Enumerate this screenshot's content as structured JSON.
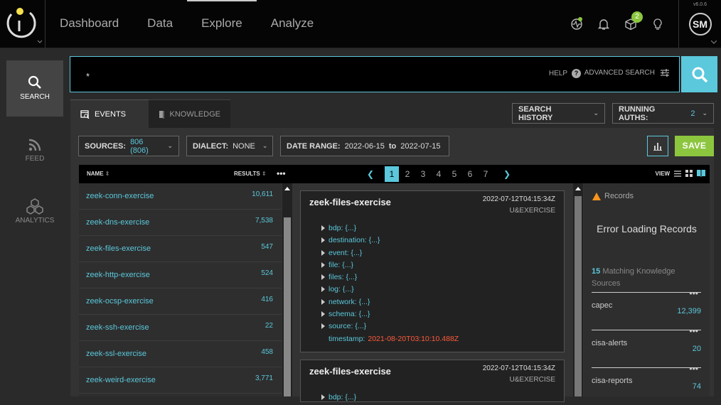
{
  "version": "v6.0.6",
  "nav": [
    "Dashboard",
    "Data",
    "Explore",
    "Analyze"
  ],
  "user_initials": "SM",
  "cube_badge": "2",
  "sidebar": [
    {
      "label": "SEARCH"
    },
    {
      "label": "FEED"
    },
    {
      "label": "ANALYTICS"
    }
  ],
  "search": {
    "value": "*",
    "help": "HELP",
    "advanced": "ADVANCED SEARCH"
  },
  "tabs": {
    "events": "EVENTS",
    "knowledge": "KNOWLEDGE"
  },
  "toolbar": {
    "search_history": "SEARCH HISTORY",
    "running_auths_label": "RUNNING AUTHS:",
    "running_auths_value": "2",
    "sources_label": "SOURCES:",
    "sources_value": "806 (806)",
    "dialect_label": "DIALECT:",
    "dialect_value": "NONE",
    "date_label": "DATE RANGE:",
    "date_from": "2022-06-15",
    "date_to_word": "to",
    "date_to": "2022-07-15",
    "save": "SAVE"
  },
  "list_header": {
    "name": "NAME",
    "results": "RESULTS",
    "more": "•••"
  },
  "pager": {
    "pages": [
      "1",
      "2",
      "3",
      "4",
      "5",
      "6",
      "7"
    ],
    "active": "1",
    "view": "VIEW"
  },
  "sources": [
    {
      "name": "zeek-conn-exercise",
      "count": "10,611"
    },
    {
      "name": "zeek-dns-exercise",
      "count": "7,538"
    },
    {
      "name": "zeek-files-exercise",
      "count": "547"
    },
    {
      "name": "zeek-http-exercise",
      "count": "524"
    },
    {
      "name": "zeek-ocsp-exercise",
      "count": "416"
    },
    {
      "name": "zeek-ssh-exercise",
      "count": "22"
    },
    {
      "name": "zeek-ssl-exercise",
      "count": "458"
    },
    {
      "name": "zeek-weird-exercise",
      "count": "3,771"
    }
  ],
  "records": [
    {
      "title": "zeek-files-exercise",
      "timestamp": "2022-07-12T04:15:34Z",
      "source": "U&EXERCISE",
      "fields": [
        "bdp: {...}",
        "destination: {...}",
        "event: {...}",
        "file: {...}",
        "files: {...}",
        "log: {...}",
        "network: {...}",
        "schema: {...}",
        "source: {...}"
      ],
      "ts_label": "timestamp:",
      "ts_value": "2021-08-20T03:10:10.488Z"
    },
    {
      "title": "zeek-files-exercise",
      "timestamp": "2022-07-12T04:15:34Z",
      "source": "U&EXERCISE",
      "partial_field": "bdp: {...}"
    }
  ],
  "knowledge_panel": {
    "heading": "Records",
    "error": "Error Loading Records",
    "match_count": "15",
    "match_text": "Matching Knowledge Sources",
    "items": [
      {
        "name": "capec",
        "count": "12,399",
        "more": "•••"
      },
      {
        "name": "cisa-alerts",
        "count": "20",
        "more": "•••"
      },
      {
        "name": "cisa-reports",
        "count": "74",
        "more": "•••"
      }
    ]
  },
  "colors": {
    "accent": "#5bc8dc",
    "save": "#8cc63f",
    "error_ts": "#ff5a3c",
    "warn": "#f7941d"
  }
}
